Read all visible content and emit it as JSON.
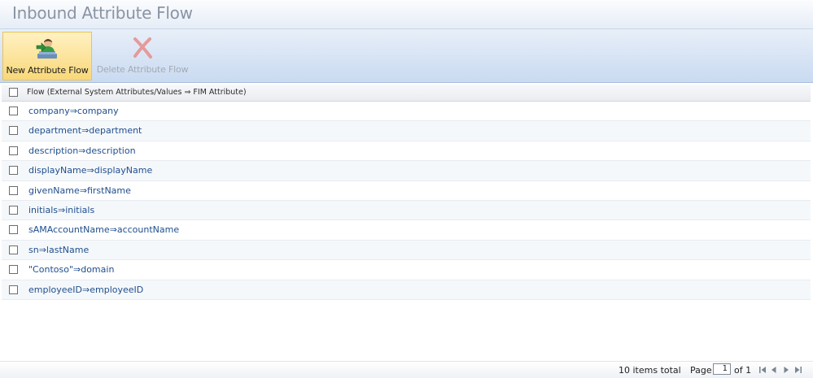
{
  "header": {
    "title": "Inbound Attribute Flow"
  },
  "toolbar": {
    "new_label": "New Attribute Flow",
    "delete_label": "Delete Attribute Flow"
  },
  "grid": {
    "column_header": "Flow (External System Attributes/Values ⇒ FIM Attribute)",
    "rows": [
      "company⇒company",
      "department⇒department",
      "description⇒description",
      "displayName⇒displayName",
      "givenName⇒firstName",
      "initials⇒initials",
      "sAMAccountName⇒accountName",
      "sn⇒lastName",
      "\"Contoso\"⇒domain",
      "employeeID⇒employeeID"
    ]
  },
  "footer": {
    "items_total": "10 items total",
    "page_label": "Page",
    "page_value": "1",
    "of_label": "of 1"
  },
  "colors": {
    "link_text": "#1f4e8c",
    "active_button": "#f9d879",
    "ribbon": "#c9daf1"
  }
}
